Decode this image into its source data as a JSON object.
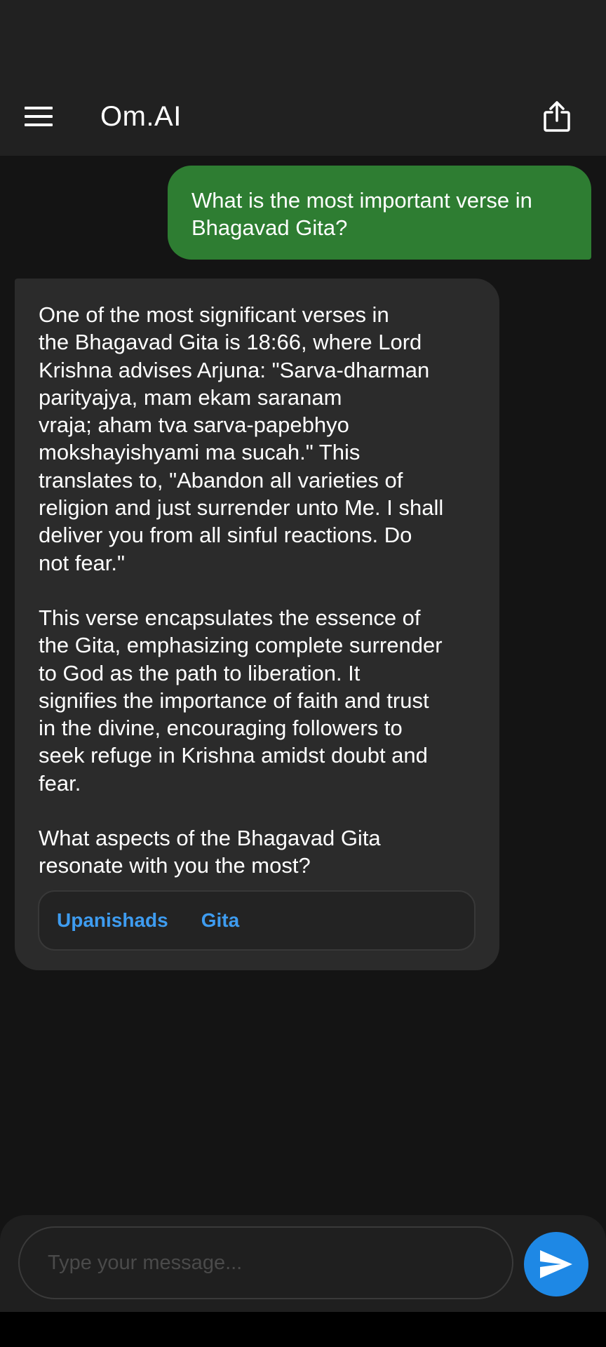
{
  "app_bar": {
    "title": "Om.AI",
    "menu_icon": "hamburger-menu-icon",
    "share_icon": "share-icon"
  },
  "messages": {
    "user": "What is the most important verse in Bhagavad Gita?",
    "bot_paragraphs": [
      "One of the most significant verses in\nthe Bhagavad Gita is 18:66, where Lord\nKrishna advises Arjuna: \"Sarva-dharman\nparityajya, mam ekam saranam\nvraja; aham tva sarva-papebhyo\nmokshayishyami ma sucah.\" This\ntranslates to, \"Abandon all varieties of\nreligion and just surrender unto Me. I shall\ndeliver you from all sinful reactions. Do\nnot fear.\"",
      "This verse encapsulates the essence of\nthe Gita, emphasizing complete surrender\nto God as the path to liberation. It\nsignifies the importance of faith and trust\nin the divine, encouraging followers to\nseek refuge in Krishna amidst doubt and\nfear.",
      "What aspects of the Bhagavad Gita\nresonate with you the most?"
    ],
    "chips": [
      "Upanishads",
      "Gita"
    ]
  },
  "composer": {
    "placeholder": "Type your message...",
    "value": "",
    "send_icon": "send-icon"
  },
  "colors": {
    "app_bar_bg": "#212121",
    "page_bg": "#141414",
    "user_bubble": "#2e7d32",
    "bot_bubble": "#2b2b2b",
    "chip_text": "#3e9cf0",
    "send_button": "#1e88e5"
  }
}
